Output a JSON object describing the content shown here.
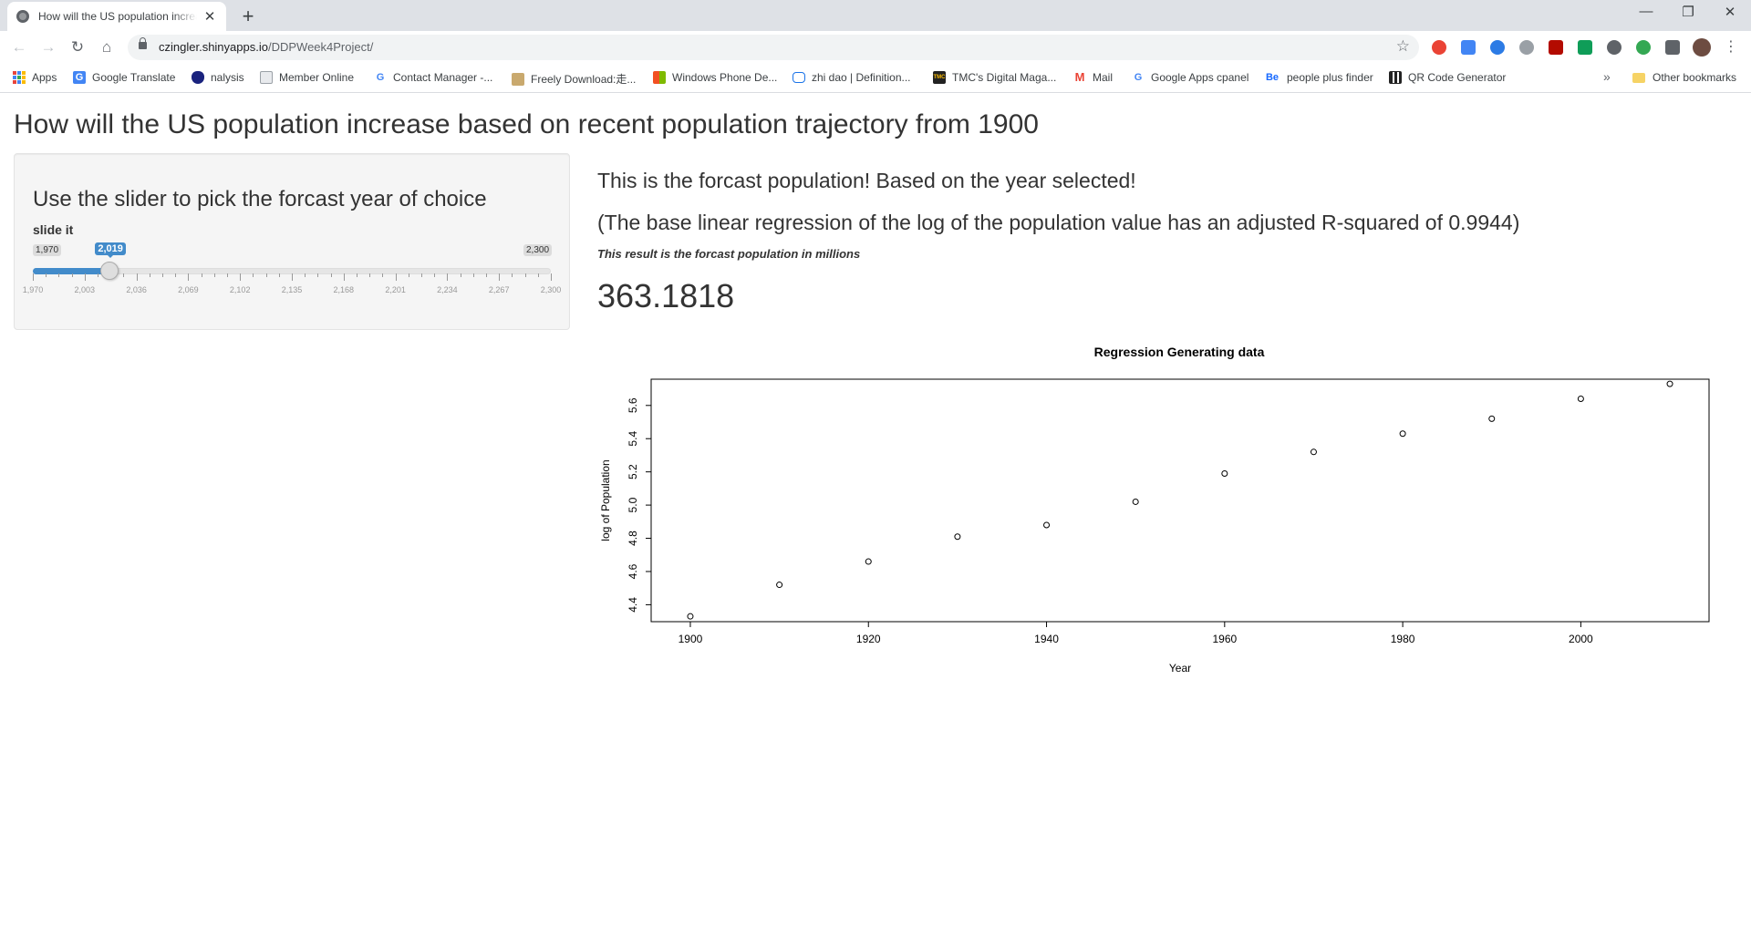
{
  "browser": {
    "tab_title": "How will the US population increase based on recent population trajectory from 1900",
    "url_host": "czingler.shinyapps.io",
    "url_path": "/DDPWeek4Project/",
    "bookmarks": [
      {
        "label": "Apps",
        "icon": "apps-grid-icon"
      },
      {
        "label": "Google Translate",
        "icon": "translate-icon",
        "color": "#4285f4"
      },
      {
        "label": "nalysis",
        "icon": "shield-icon",
        "color": "#1a237e"
      },
      {
        "label": "Member Online",
        "icon": "document-icon",
        "color": "#9aa0a6"
      },
      {
        "label": "Contact Manager -...",
        "icon": "google-icon",
        "color": "#4285f4"
      },
      {
        "label": "Freely Download:走...",
        "icon": "image-icon",
        "color": "#c9a96e"
      },
      {
        "label": "Windows Phone De...",
        "icon": "windows-icon",
        "color": "#f25022"
      },
      {
        "label": "zhi dao | Definition...",
        "icon": "tv-icon",
        "color": "#1a73e8"
      },
      {
        "label": "TMC's Digital Maga...",
        "icon": "tmc-icon",
        "color": "#222"
      },
      {
        "label": "Mail",
        "icon": "gmail-icon",
        "color": "#ea4335"
      },
      {
        "label": "Google Apps cpanel",
        "icon": "google-icon",
        "color": "#4285f4"
      },
      {
        "label": "people plus finder",
        "icon": "behance-icon",
        "color": "#1769ff"
      },
      {
        "label": "QR Code Generator",
        "icon": "qr-icon",
        "color": "#222"
      }
    ],
    "other_bookmarks": "Other bookmarks"
  },
  "page": {
    "title": "How will the US population increase based on recent population trajectory from 1900"
  },
  "sidebar": {
    "heading": "Use the slider to pick the forcast year of choice",
    "slider_label": "slide it",
    "slider_min_label": "1,970",
    "slider_max_label": "2,300",
    "slider_value_label": "2,019",
    "slider_min": 1970,
    "slider_max": 2300,
    "slider_value": 2019,
    "tick_labels": [
      "1,970",
      "2,003",
      "2,036",
      "2,069",
      "2,102",
      "2,135",
      "2,168",
      "2,201",
      "2,234",
      "2,267",
      "2,300"
    ]
  },
  "main": {
    "heading": "This is the forcast population! Based on the year selected!",
    "regression_note": "(The base linear regression of the log of the population value has an adjusted R-squared of 0.9944)",
    "result_caption": "This result is the forcast population in millions",
    "result_value": "363.1818"
  },
  "chart_data": {
    "type": "scatter",
    "title": "Regression Generating data",
    "xlabel": "Year",
    "ylabel": "log of Population",
    "x": [
      1900,
      1910,
      1920,
      1930,
      1940,
      1950,
      1960,
      1970,
      1980,
      1990,
      2000,
      2010
    ],
    "y": [
      4.33,
      4.52,
      4.66,
      4.81,
      4.88,
      5.02,
      5.19,
      5.32,
      5.43,
      5.52,
      5.64,
      5.73
    ],
    "xlim": [
      1895.6,
      2014.4
    ],
    "ylim": [
      4.298,
      5.758
    ],
    "xticks": [
      1900,
      1920,
      1940,
      1960,
      1980,
      2000
    ],
    "yticks": [
      4.4,
      4.6,
      4.8,
      5.0,
      5.2,
      5.4,
      5.6
    ],
    "ytick_labels": [
      "4.4",
      "4.6",
      "4.8",
      "5.0",
      "5.2",
      "5.4",
      "5.6"
    ],
    "marker": "open-circle",
    "grid": false
  }
}
